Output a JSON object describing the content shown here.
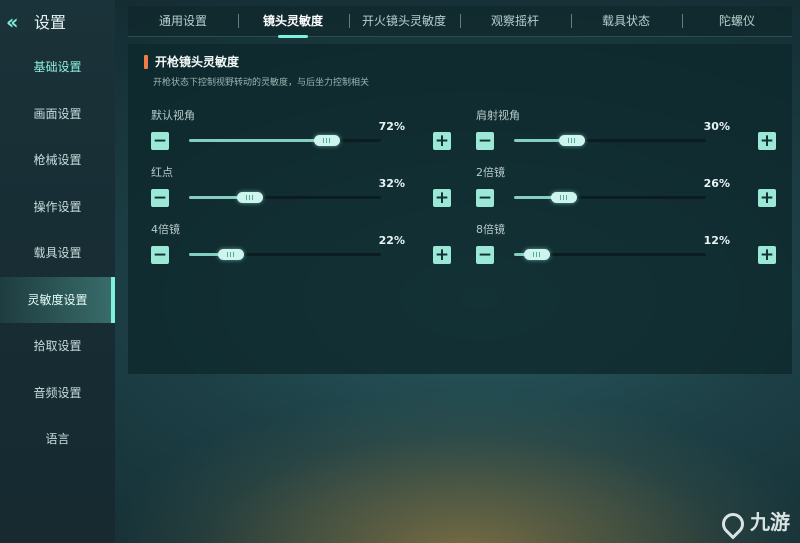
{
  "header": {
    "back_icon": "double-chevron-left-icon",
    "title": "设置"
  },
  "sidebar": {
    "items": [
      {
        "label": "基础设置"
      },
      {
        "label": "画面设置"
      },
      {
        "label": "枪械设置"
      },
      {
        "label": "操作设置"
      },
      {
        "label": "载具设置"
      },
      {
        "label": "灵敏度设置"
      },
      {
        "label": "拾取设置"
      },
      {
        "label": "音频设置"
      },
      {
        "label": "语言"
      }
    ],
    "active_index": 5
  },
  "tabs": [
    {
      "label": "通用设置"
    },
    {
      "label": "镜头灵敏度"
    },
    {
      "label": "开火镜头灵敏度"
    },
    {
      "label": "观察摇杆"
    },
    {
      "label": "载具状态"
    },
    {
      "label": "陀螺仪"
    }
  ],
  "active_tab": 1,
  "section": {
    "title": "开枪镜头灵敏度",
    "description": "开枪状态下控制视野转动的灵敏度，与后坐力控制相关"
  },
  "settings": [
    {
      "label": "默认视角",
      "value": 72,
      "display": "72%"
    },
    {
      "label": "肩射视角",
      "value": 30,
      "display": "30%"
    },
    {
      "label": "红点",
      "value": 32,
      "display": "32%"
    },
    {
      "label": "2倍镜",
      "value": 26,
      "display": "26%"
    },
    {
      "label": "4倍镜",
      "value": 22,
      "display": "22%"
    },
    {
      "label": "8倍镜",
      "value": 12,
      "display": "12%"
    }
  ],
  "buttons": {
    "minus": "−",
    "plus": "+"
  },
  "watermark": {
    "icon": "jiuyou-logo-icon",
    "text": "九游"
  },
  "colors": {
    "accent": "#7ef0dc",
    "section_marker": "#f07c4a",
    "button": "#9be8d6"
  }
}
